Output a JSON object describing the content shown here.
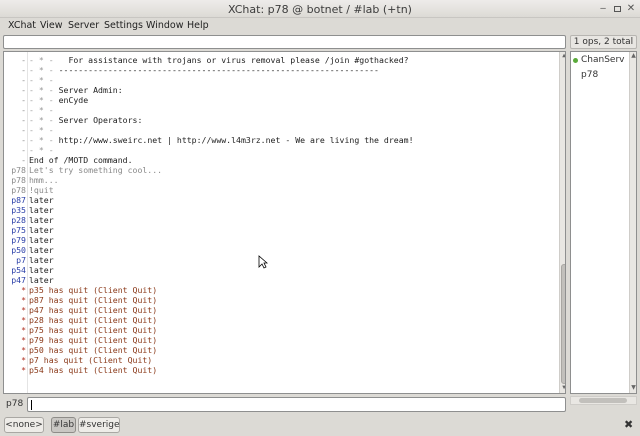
{
  "window": {
    "title": "XChat: p78 @ botnet / #lab (+tn)",
    "min_icon": "minimize-icon",
    "max_icon": "maximize-icon",
    "close_icon": "close-icon"
  },
  "menu": [
    "XChat",
    "View",
    "Server",
    "Settings",
    "Window",
    "Help"
  ],
  "topic": {
    "value": ""
  },
  "user_count": "1 ops, 2 total",
  "users": [
    {
      "name": "ChanServ",
      "op": true
    },
    {
      "name": "p78",
      "op": false
    }
  ],
  "chat_lines": [
    {
      "nick": "-",
      "marker": "- * -",
      "text": "   For assistance with trojans or virus removal please /join #gothacked?",
      "kind": "motd"
    },
    {
      "nick": "-",
      "marker": "- * -",
      "text": " -----------------------------------------------------------------",
      "kind": "motd"
    },
    {
      "nick": "-",
      "marker": "- * -",
      "text": "",
      "kind": "motd"
    },
    {
      "nick": "-",
      "marker": "- * -",
      "text": " Server Admin:",
      "kind": "motd"
    },
    {
      "nick": "-",
      "marker": "- * -",
      "text": " enCyde",
      "kind": "motd"
    },
    {
      "nick": "-",
      "marker": "- * -",
      "text": "",
      "kind": "motd"
    },
    {
      "nick": "-",
      "marker": "- * -",
      "text": " Server Operators:",
      "kind": "motd"
    },
    {
      "nick": "-",
      "marker": "- * -",
      "text": "",
      "kind": "motd"
    },
    {
      "nick": "-",
      "marker": "- * -",
      "text": " http://www.sweirc.net | http://www.l4m3rz.net - We are living the dream!",
      "kind": "motd"
    },
    {
      "nick": "-",
      "marker": "- * -",
      "text": "",
      "kind": "motd"
    },
    {
      "nick": "-",
      "marker": "",
      "text": "End of /MOTD command.",
      "kind": "server"
    },
    {
      "nick": "p78",
      "marker": "",
      "text": "Let's try something cool...",
      "kind": "self"
    },
    {
      "nick": "p78",
      "marker": "",
      "text": "hmm...",
      "kind": "self"
    },
    {
      "nick": "p78",
      "marker": "",
      "text": "!quit",
      "kind": "self"
    },
    {
      "nick": "p87",
      "marker": "",
      "text": "later",
      "kind": "other"
    },
    {
      "nick": "p35",
      "marker": "",
      "text": "later",
      "kind": "other"
    },
    {
      "nick": "p28",
      "marker": "",
      "text": "later",
      "kind": "other"
    },
    {
      "nick": "p75",
      "marker": "",
      "text": "later",
      "kind": "other"
    },
    {
      "nick": "p79",
      "marker": "",
      "text": "later",
      "kind": "other"
    },
    {
      "nick": "p50",
      "marker": "",
      "text": "later",
      "kind": "other"
    },
    {
      "nick": "p7",
      "marker": "",
      "text": "later",
      "kind": "other"
    },
    {
      "nick": "p54",
      "marker": "",
      "text": "later",
      "kind": "other"
    },
    {
      "nick": "p47",
      "marker": "",
      "text": "later",
      "kind": "other"
    },
    {
      "nick": "*",
      "marker": "",
      "text": "p35 has quit (Client Quit)",
      "kind": "quit"
    },
    {
      "nick": "*",
      "marker": "",
      "text": "p87 has quit (Client Quit)",
      "kind": "quit"
    },
    {
      "nick": "*",
      "marker": "",
      "text": "p47 has quit (Client Quit)",
      "kind": "quit"
    },
    {
      "nick": "*",
      "marker": "",
      "text": "p28 has quit (Client Quit)",
      "kind": "quit"
    },
    {
      "nick": "*",
      "marker": "",
      "text": "p75 has quit (Client Quit)",
      "kind": "quit"
    },
    {
      "nick": "*",
      "marker": "",
      "text": "p79 has quit (Client Quit)",
      "kind": "quit"
    },
    {
      "nick": "*",
      "marker": "",
      "text": "p50 has quit (Client Quit)",
      "kind": "quit"
    },
    {
      "nick": "*",
      "marker": "",
      "text": "p7 has quit (Client Quit)",
      "kind": "quit"
    },
    {
      "nick": "*",
      "marker": "",
      "text": "p54 has quit (Client Quit)",
      "kind": "quit"
    }
  ],
  "colors": {
    "self": "#8a8a8a",
    "other": "#2a3fa8",
    "quit": "#8b3a1a",
    "quit_star": "#b03020",
    "motd_dash": "#999999",
    "text": "#222222"
  },
  "input": {
    "nick": "p78",
    "value": ""
  },
  "tabs": [
    {
      "label": "<none>",
      "active": false
    },
    {
      "label": "#lab",
      "active": true
    },
    {
      "label": "#sverige",
      "active": false
    }
  ],
  "tab_close_icon": "close-icon",
  "scroll_position": 0.98
}
